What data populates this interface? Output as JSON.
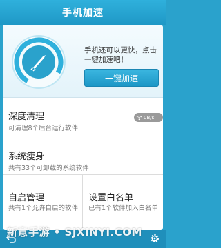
{
  "header": {
    "title": "手机加速"
  },
  "hero": {
    "message": "手机还可以更快，点击一键加速吧！",
    "boost_label": "一键加速"
  },
  "deep_clean": {
    "title": "深度清理",
    "subtitle": "可清理8个后台运行软件"
  },
  "slim": {
    "title": "系统瘦身",
    "subtitle": "共有33个可卸载的系统软件",
    "speed_badge": "0B/s"
  },
  "autostart": {
    "title": "自启管理",
    "subtitle": "共有1个允许自启的软件"
  },
  "whitelist": {
    "title": "设置白名单",
    "subtitle": "已有1个软件加入白名单"
  },
  "watermark": "新意手游 • SJXINYI.COM",
  "colors": {
    "accent": "#2aa2cc",
    "button": "#1d97c6"
  },
  "icons": {
    "gauge": "rocket-gauge-icon",
    "network": "wifi-icon",
    "back": "back-icon",
    "settings": "gear-icon"
  }
}
